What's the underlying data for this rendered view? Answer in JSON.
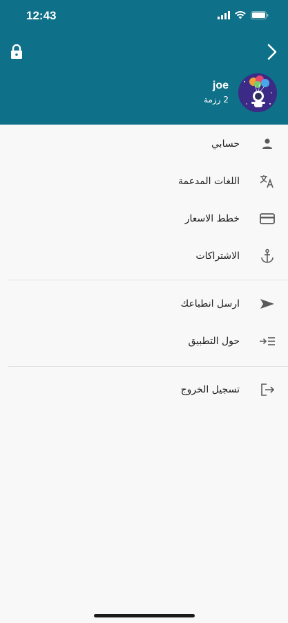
{
  "status_bar": {
    "time": "12:43"
  },
  "header": {
    "bg_color": "#0f7089",
    "left_icon": "lock-icon",
    "right_icon": "chevron-right-icon"
  },
  "profile": {
    "username": "joe",
    "package": "2 رزمة",
    "avatar": "astronaut-avatar"
  },
  "menu_group_1": [
    {
      "label": "حسابي",
      "icon": "person-icon"
    },
    {
      "label": "اللغات المدعمة",
      "icon": "translate-icon"
    },
    {
      "label": "خطط الاسعار",
      "icon": "credit-card-icon"
    },
    {
      "label": "الاشتراكات",
      "icon": "anchor-icon"
    }
  ],
  "menu_group_2": [
    {
      "label": "ارسل انطباعك",
      "icon": "send-icon"
    },
    {
      "label": "حول التطبيق",
      "icon": "about-icon"
    }
  ],
  "menu_group_3": [
    {
      "label": "تسجيل الخروج",
      "icon": "logout-icon"
    }
  ]
}
